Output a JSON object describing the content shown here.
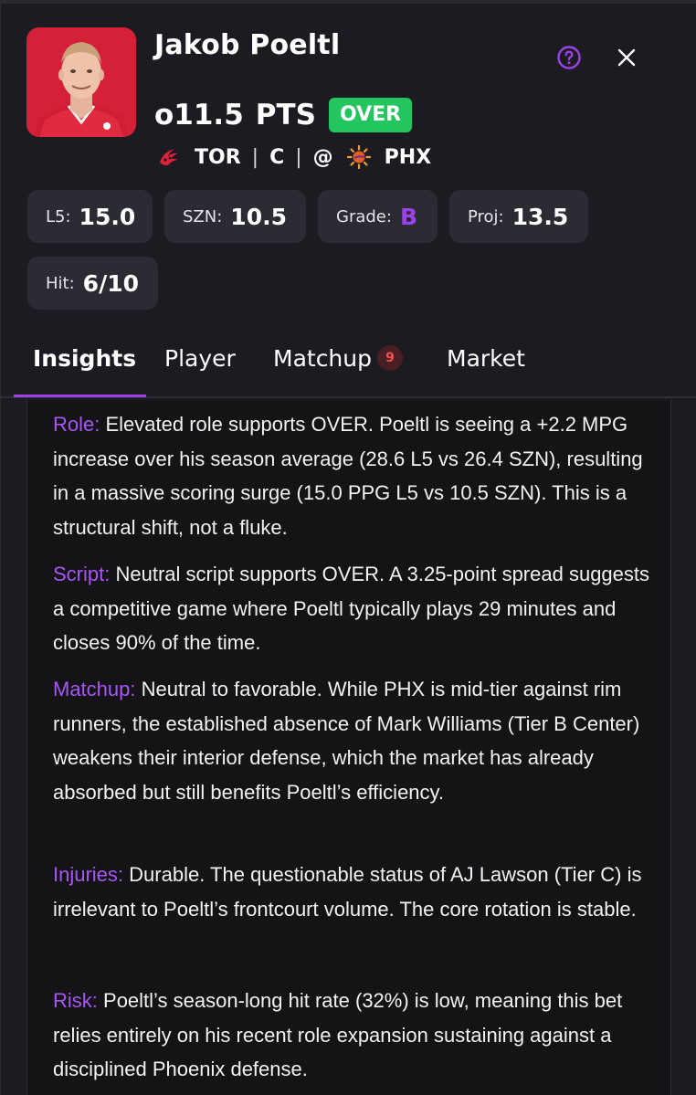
{
  "player": {
    "name": "Jakob Poeltl",
    "avatar_icon": "player-headshot"
  },
  "prop": {
    "line": "o11.5",
    "stat": "PTS",
    "pick": "OVER",
    "pick_color": "#22c55e"
  },
  "matchup": {
    "team": "TOR",
    "team_icon": "raptors-logo",
    "position": "C",
    "at": "@",
    "opponent": "PHX",
    "opponent_icon": "suns-logo"
  },
  "header_icons": {
    "help": "question-circle-icon",
    "close": "close-icon"
  },
  "stats": {
    "l5": {
      "label": "L5:",
      "value": "15.0"
    },
    "szn": {
      "label": "SZN:",
      "value": "10.5"
    },
    "grade": {
      "label": "Grade:",
      "value": "B"
    },
    "proj": {
      "label": "Proj:",
      "value": "13.5"
    },
    "hit": {
      "label": "Hit:",
      "value": "6/10"
    }
  },
  "tabs": [
    {
      "label": "Insights",
      "active": true
    },
    {
      "label": "Player"
    },
    {
      "label": "Matchup",
      "badge": "9"
    },
    {
      "label": "Market"
    }
  ],
  "colors": {
    "accent": "#9b42e6",
    "badge_red": "#f05252",
    "background": "#1b1b21"
  },
  "insights": [
    {
      "label": "Role:",
      "text": "Elevated role supports OVER. Poeltl is seeing a +2.2 MPG increase over his season average (28.6 L5 vs 26.4 SZN), resulting in a massive scoring surge (15.0 PPG L5 vs 10.5 SZN). This is a structural shift, not a fluke."
    },
    {
      "label": "Script:",
      "text": "Neutral script supports OVER. A 3.25-point spread suggests a competitive game where Poeltl typically plays 29 minutes and closes 90% of the time."
    },
    {
      "label": "Matchup:",
      "text": "Neutral to favorable. While PHX is mid-tier against rim runners, the established absence of Mark Williams (Tier B Center) weakens their interior defense, which the market has already absorbed but still benefits Poeltl’s efficiency."
    },
    {
      "label": "Injuries:",
      "text": "Durable. The questionable status of AJ Lawson (Tier C) is irrelevant to Poeltl’s frontcourt volume. The core rotation is stable."
    },
    {
      "label": "Risk:",
      "text": "Poeltl’s season-long hit rate (32%) is low, meaning this bet relies entirely on his recent role expansion sustaining against a disciplined Phoenix defense."
    }
  ]
}
